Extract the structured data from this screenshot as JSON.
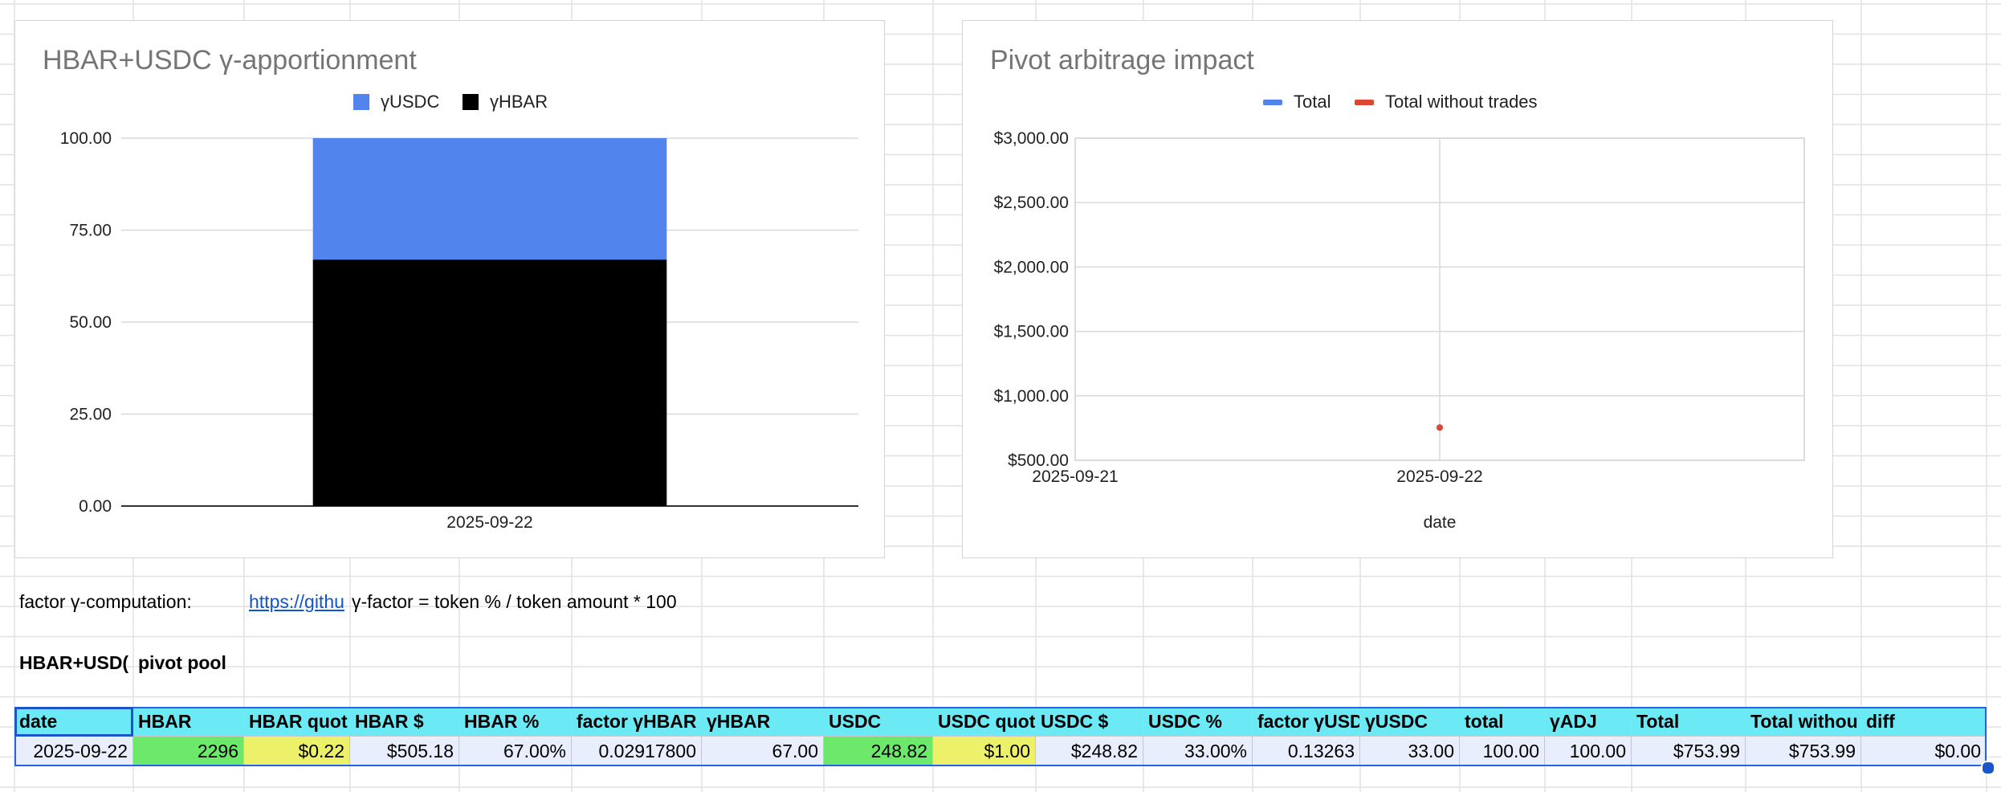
{
  "colors": {
    "usdc_series": "#5284ee",
    "hbar_series": "#000000",
    "total_series": "#4e84ec",
    "total_without_trades_series": "#df4533",
    "table_header": "#6be9f5",
    "table_row": "#e8eefc",
    "highlight_green": "#6ce96a",
    "highlight_yellow": "#edf16a",
    "selection": "#1a56c9"
  },
  "chart_data": [
    {
      "type": "bar",
      "stacked": true,
      "title": "HBAR+USDC γ-apportionment",
      "legend_position": "top",
      "categories": [
        "2025-09-22"
      ],
      "series": [
        {
          "name": "γUSDC",
          "values": [
            33
          ]
        },
        {
          "name": "γHBAR",
          "values": [
            67
          ]
        }
      ],
      "ylim": [
        0,
        100
      ],
      "yticks": [
        "0.00",
        "25.00",
        "50.00",
        "75.00",
        "100.00"
      ],
      "grid": true
    },
    {
      "type": "line",
      "title": "Pivot arbitrage impact",
      "legend_position": "top",
      "xlabel": "date",
      "x": [
        "2025-09-22"
      ],
      "xticks": [
        "2025-09-21",
        "2025-09-22"
      ],
      "series": [
        {
          "name": "Total",
          "values": [
            753.99
          ]
        },
        {
          "name": "Total without trades",
          "values": [
            753.99
          ]
        }
      ],
      "ylim": [
        500,
        3000
      ],
      "yticks": [
        "$500.00",
        "$1,000.00",
        "$1,500.00",
        "$2,000.00",
        "$2,500.00",
        "$3,000.00"
      ],
      "grid": true
    }
  ],
  "notes": {
    "factor_label": "factor γ-computation:",
    "link_text": "https://githu",
    "formula": "γ-factor = token % / token amount * 100",
    "pool_title_a": "HBAR+USD(",
    "pool_title_b": "pivot pool"
  },
  "table": {
    "headers": [
      "date",
      "HBAR",
      "HBAR quot",
      "HBAR $",
      "HBAR %",
      "factor γHBAR",
      "γHBAR",
      "USDC",
      "USDC quot",
      "USDC $",
      "USDC %",
      "factor γUSD",
      "γUSDC",
      "total",
      "γADJ",
      "Total",
      "Total withou",
      "diff"
    ],
    "rows": [
      [
        "2025-09-22",
        "2296",
        "$0.22",
        "$505.18",
        "67.00%",
        "0.02917800",
        "67.00",
        "248.82",
        "$1.00",
        "$248.82",
        "33.00%",
        "0.13263",
        "33.00",
        "100.00",
        "100.00",
        "$753.99",
        "$753.99",
        "$0.00"
      ]
    ]
  }
}
